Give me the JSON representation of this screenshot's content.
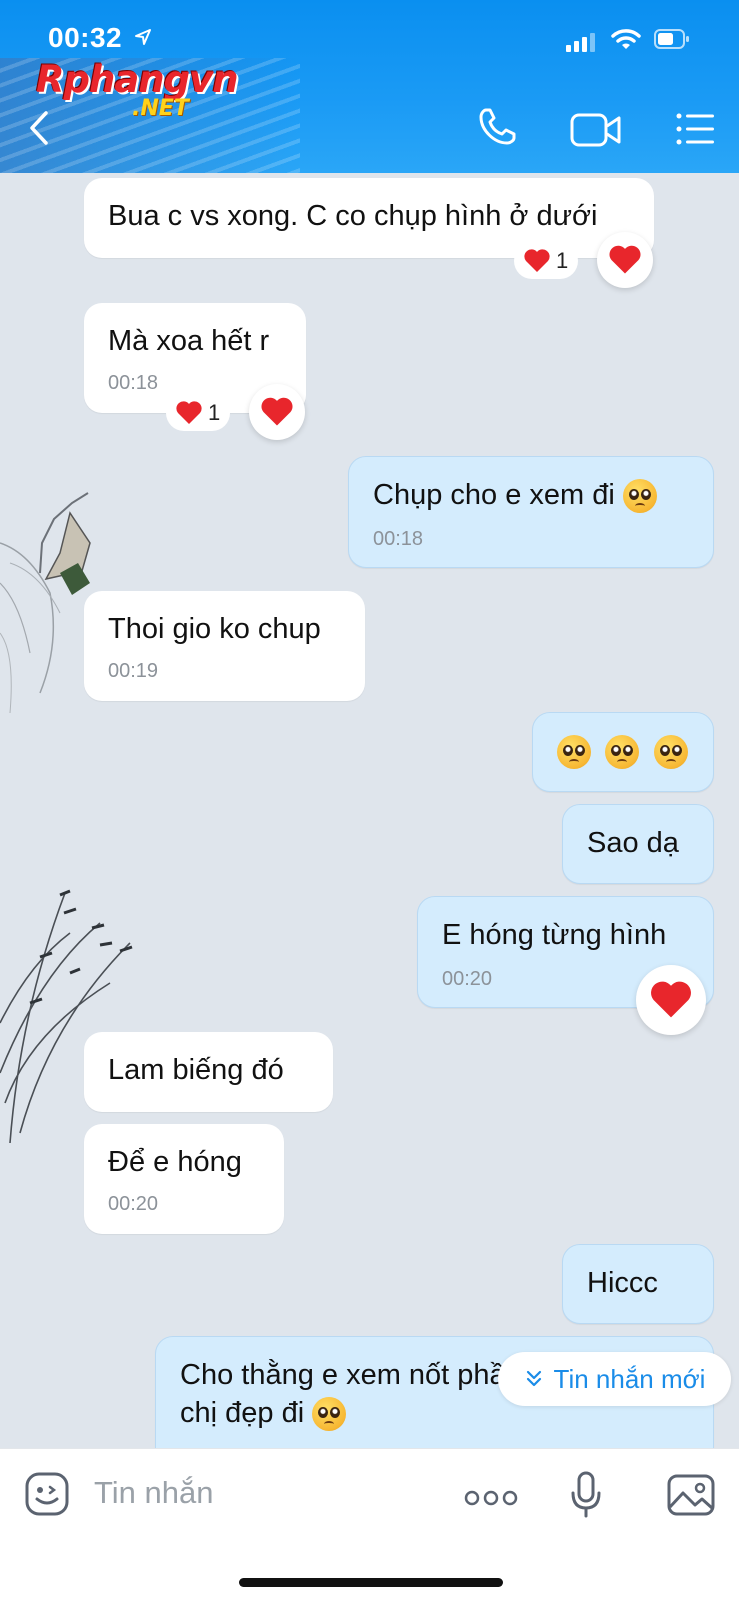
{
  "status_bar": {
    "time": "00:32"
  },
  "header": {
    "logo_main": "Rphangvn",
    "logo_suffix": ".NET",
    "icons": [
      "back-icon",
      "phone-icon",
      "video-call-icon",
      "menu-icon"
    ]
  },
  "messages": [
    {
      "side": "in",
      "text": "Bua c vs xong. C co chụp hình ở dưới",
      "time": "",
      "reaction_count": "1"
    },
    {
      "side": "in",
      "text": "Mà xoa hết r",
      "time": "00:18",
      "reaction_count": "1"
    },
    {
      "side": "out",
      "text": "Chụp cho e xem đi",
      "emoji": "pleading-face",
      "time": "00:18"
    },
    {
      "side": "in",
      "text": "Thoi gio ko chup",
      "time": "00:19"
    },
    {
      "side": "out",
      "emoji": "pleading-face x3"
    },
    {
      "side": "out",
      "text": "Sao dạ"
    },
    {
      "side": "out",
      "text": "E hóng từng hình",
      "time": "00:20",
      "reaction": "heart"
    },
    {
      "side": "in",
      "text": "Lam biếng đó"
    },
    {
      "side": "in",
      "text": "Để e hóng",
      "time": "00:20"
    },
    {
      "side": "out",
      "text": "Hiccc"
    },
    {
      "side": "out",
      "text_line1": "Cho thằng e xem nốt phần dưới của",
      "text_line2": "chị đẹp đi",
      "emoji": "pleading-face"
    }
  ],
  "new_messages_label": "Tin nhắn mới",
  "composer": {
    "placeholder": "Tin nhắn",
    "icons": [
      "sticker-icon",
      "more-icon",
      "mic-icon",
      "image-icon"
    ]
  },
  "colors": {
    "header_blue": "#0a8ff0",
    "outgoing_bubble": "#d4ecfd",
    "incoming_bubble": "#ffffff",
    "chat_background": "#dfe5ec",
    "link_blue": "#1a8ce8",
    "heart_red": "#e8262c"
  }
}
